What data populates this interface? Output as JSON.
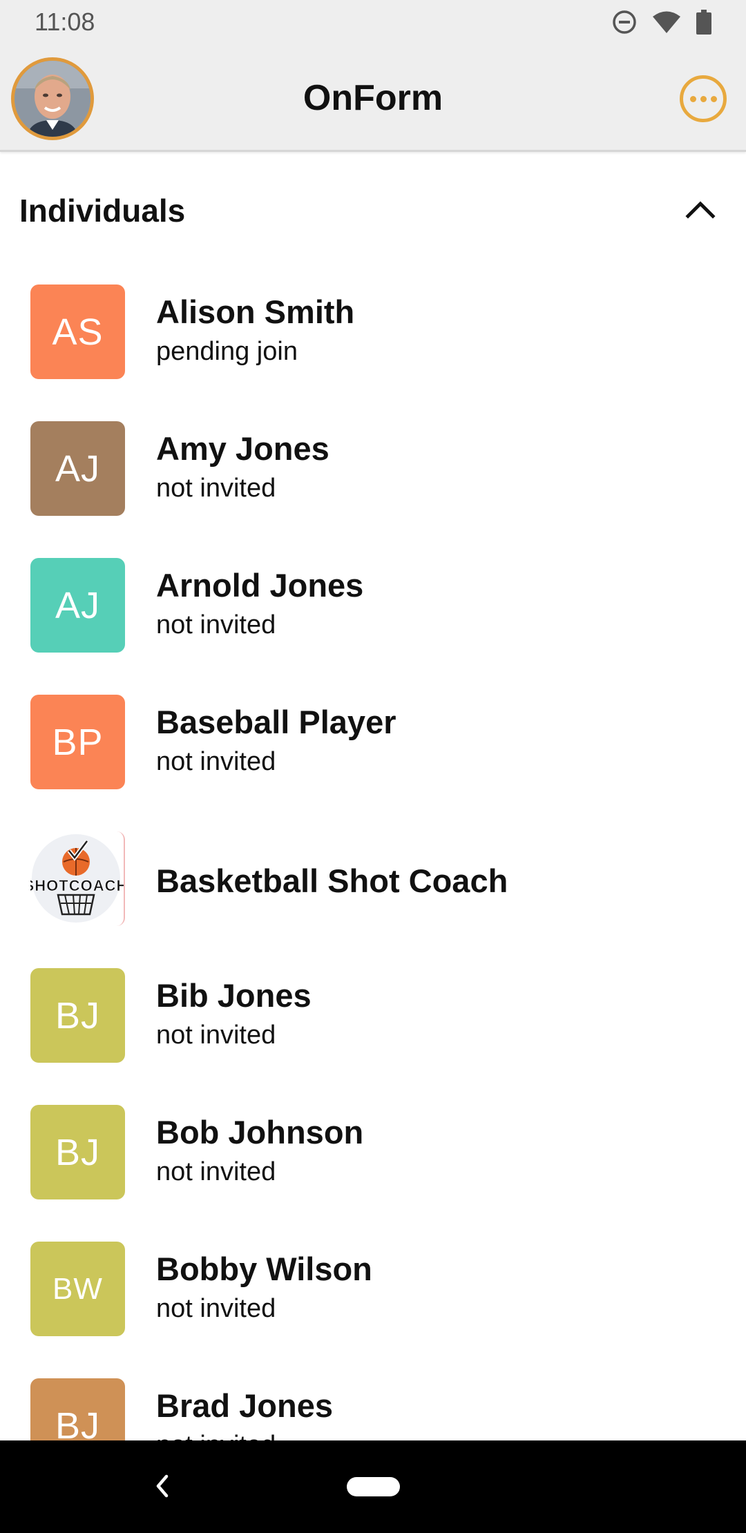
{
  "status_bar": {
    "time": "11:08",
    "icons": [
      "do-not-disturb-icon",
      "wifi-icon",
      "battery-icon"
    ]
  },
  "app_bar": {
    "title": "OnForm",
    "avatar": "user-avatar-photo",
    "more_icon": "more-horizontal-icon",
    "accent_color": "#e8a93e"
  },
  "section": {
    "title": "Individuals",
    "toggle_icon": "chevron-up-icon"
  },
  "individuals": [
    {
      "initials": "AS",
      "name": "Alison Smith",
      "status": "pending join",
      "color": "#fb8455"
    },
    {
      "initials": "AJ",
      "name": "Amy Jones",
      "status": "not invited",
      "color": "#a47f5e"
    },
    {
      "initials": "AJ",
      "name": "Arnold Jones",
      "status": "not invited",
      "color": "#56cfb7"
    },
    {
      "initials": "BP",
      "name": "Baseball Player",
      "status": "not invited",
      "color": "#fb8455"
    },
    {
      "logo_text": "SHOTCOACH",
      "name": "Basketball Shot Coach",
      "status": "",
      "color": "#ffffff"
    },
    {
      "initials": "BJ",
      "name": "Bib Jones",
      "status": "not invited",
      "color": "#cbc65a"
    },
    {
      "initials": "BJ",
      "name": "Bob Johnson",
      "status": "not invited",
      "color": "#cbc65a"
    },
    {
      "initials": "BW",
      "name": "Bobby Wilson",
      "status": "not invited",
      "color": "#cbc65a"
    },
    {
      "initials": "BJ",
      "name": "Brad Jones",
      "status": "not invited",
      "color": "#cf9156"
    }
  ],
  "nav_bar": {
    "back_icon": "back-chevron-icon",
    "home_icon": "home-pill-icon"
  }
}
